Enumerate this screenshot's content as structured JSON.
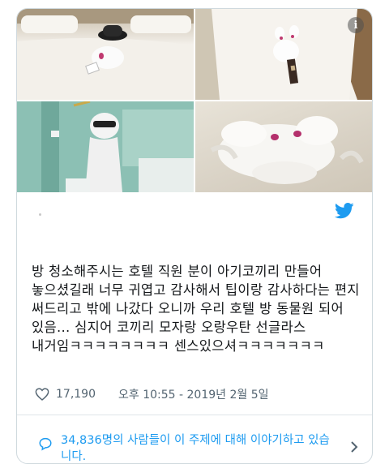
{
  "photos": [
    {
      "name": "bed-with-elephant-towel-photo"
    },
    {
      "name": "swan-towel-photo"
    },
    {
      "name": "bathroom-orangutan-photo"
    },
    {
      "name": "towel-animal-closeup-photo"
    }
  ],
  "icons": {
    "info": "info-icon",
    "brand": "twitter-bird-icon",
    "like": "heart-icon",
    "conversation": "speech-bubble-icon",
    "more": "chevron-right-icon"
  },
  "tweet": {
    "text": "방 청소해주시는 호텔 직원 분이 아기코끼리 만들어 놓으셨길래 너무 귀엽고 감사해서 팁이랑 감사하다는 편지 써드리고 밖에 나갔다 오니까 우리 호텔 방 동물원 되어 있음... 심지어 코끼리 모자랑 오랑우탄 선글라스 내거임ㅋㅋㅋㅋㅋㅋㅋㅋ 센스있으셔ㅋㅋㅋㅋㅋㅋㅋ",
    "likes": "17,190",
    "timestamp": "오후 10:55 - 2019년 2월 5일",
    "info_glyph": "i"
  },
  "conversation": {
    "text": "34,836명의 사람들이 이 주제에 대해 이야기하고 있습니다."
  },
  "colors": {
    "accent": "#1d9bf0",
    "meta": "#536471",
    "border": "#cfd9de"
  }
}
